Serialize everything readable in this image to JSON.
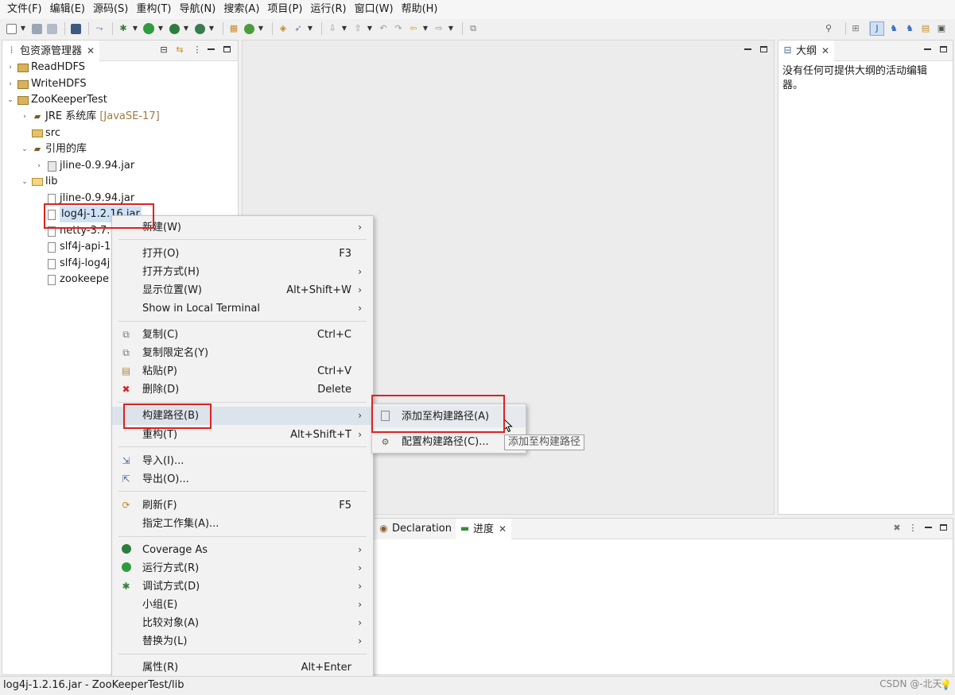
{
  "menubar": [
    "文件(F)",
    "编辑(E)",
    "源码(S)",
    "重构(T)",
    "导航(N)",
    "搜索(A)",
    "项目(P)",
    "运行(R)",
    "窗口(W)",
    "帮助(H)"
  ],
  "package_explorer": {
    "tab_label": "包资源管理器",
    "tree": [
      {
        "label": "ReadHDFS",
        "icon": "project-icon"
      },
      {
        "label": "WriteHDFS",
        "icon": "project-icon"
      },
      {
        "label": "ZooKeeperTest",
        "icon": "project-icon"
      },
      {
        "label": "JRE 系统库",
        "decoration": "[JavaSE-17]",
        "icon": "library-icon"
      },
      {
        "label": "src",
        "icon": "source-folder-icon"
      },
      {
        "label": "引用的库",
        "icon": "library-icon"
      },
      {
        "label": "jline-0.9.94.jar",
        "icon": "jar-icon"
      },
      {
        "label": "lib",
        "icon": "folder-icon"
      },
      {
        "label": "jline-0.9.94.jar",
        "icon": "file-icon"
      },
      {
        "label": "log4j-1.2.16.jar",
        "icon": "file-icon"
      },
      {
        "label": "netty-3.7.",
        "icon": "file-icon"
      },
      {
        "label": "slf4j-api-1",
        "icon": "file-icon"
      },
      {
        "label": "slf4j-log4j",
        "icon": "file-icon"
      },
      {
        "label": "zookeepe",
        "icon": "file-icon"
      }
    ]
  },
  "outline": {
    "tab_label": "大纲",
    "message": "没有任何可提供大纲的活动编辑器。"
  },
  "bottom_panel": {
    "tabs": [
      "Declaration",
      "进度"
    ]
  },
  "context_menu": {
    "items": [
      {
        "label": "新建(W)",
        "accel": "",
        "submenu": true
      },
      {
        "label": "打开(O)",
        "accel": "F3",
        "submenu": false
      },
      {
        "label": "打开方式(H)",
        "accel": "",
        "submenu": true
      },
      {
        "label": "显示位置(W)",
        "accel": "Alt+Shift+W",
        "submenu": true
      },
      {
        "label": "Show in Local Terminal",
        "accel": "",
        "submenu": true
      },
      {
        "label": "复制(C)",
        "accel": "Ctrl+C",
        "submenu": false
      },
      {
        "label": "复制限定名(Y)",
        "accel": "",
        "submenu": false
      },
      {
        "label": "粘贴(P)",
        "accel": "Ctrl+V",
        "submenu": false
      },
      {
        "label": "删除(D)",
        "accel": "Delete",
        "submenu": false
      },
      {
        "label": "构建路径(B)",
        "accel": "",
        "submenu": true
      },
      {
        "label": "重构(T)",
        "accel": "Alt+Shift+T",
        "submenu": true
      },
      {
        "label": "导入(I)...",
        "accel": "",
        "submenu": false
      },
      {
        "label": "导出(O)...",
        "accel": "",
        "submenu": false
      },
      {
        "label": "刷新(F)",
        "accel": "F5",
        "submenu": false
      },
      {
        "label": "指定工作集(A)...",
        "accel": "",
        "submenu": false
      },
      {
        "label": "Coverage As",
        "accel": "",
        "submenu": true
      },
      {
        "label": "运行方式(R)",
        "accel": "",
        "submenu": true
      },
      {
        "label": "调试方式(D)",
        "accel": "",
        "submenu": true
      },
      {
        "label": "小组(E)",
        "accel": "",
        "submenu": true
      },
      {
        "label": "比较对象(A)",
        "accel": "",
        "submenu": true
      },
      {
        "label": "替换为(L)",
        "accel": "",
        "submenu": true
      },
      {
        "label": "属性(R)",
        "accel": "Alt+Enter",
        "submenu": false
      }
    ]
  },
  "build_path_submenu": {
    "items": [
      "添加至构建路径(A)",
      "配置构建路径(C)..."
    ]
  },
  "tooltip": "添加至构建路径",
  "statusbar": "log4j-1.2.16.jar - ZooKeeperTest/lib",
  "watermark": "CSDN @-北天-",
  "colors": {
    "highlight_box": "#e02020",
    "selection": "#cfe3f7",
    "menu_hover": "#dde3ea",
    "decoration": "#a07a3c"
  }
}
